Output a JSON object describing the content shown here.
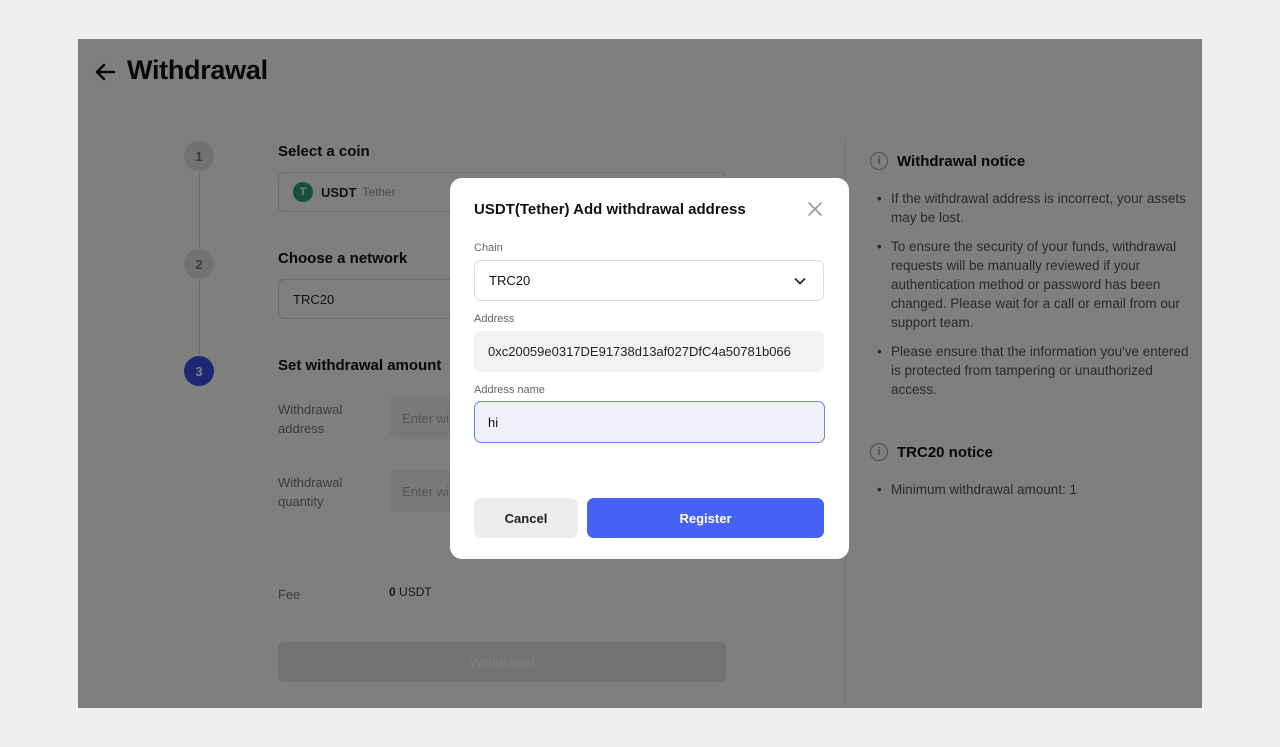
{
  "page": {
    "title": "Withdrawal"
  },
  "steps": [
    {
      "number": "1",
      "title": "Select a coin"
    },
    {
      "number": "2",
      "title": "Choose a network"
    },
    {
      "number": "3",
      "title": "Set withdrawal amount"
    }
  ],
  "coin": {
    "symbol": "USDT",
    "name": "Tether",
    "icon_letter": "T"
  },
  "network": {
    "value": "TRC20"
  },
  "amount_form": {
    "address_label": "Withdrawal address",
    "address_placeholder": "Enter wi",
    "quantity_label": "Withdrawal quantity",
    "quantity_placeholder": "Enter wi",
    "fee_label": "Fee",
    "fee_amount": "0",
    "fee_unit": "USDT",
    "submit_label": "Withdrawal"
  },
  "withdrawal_notice": {
    "title": "Withdrawal notice",
    "items": [
      "If the withdrawal address is incorrect, your assets may be lost.",
      "To ensure the security of your funds, withdrawal requests will be manually reviewed if your authentication method or password has been changed. Please wait for a call or email from our support team.",
      "Please ensure that the information you've entered is protected from tampering or unauthorized access."
    ]
  },
  "trc20_notice": {
    "title": "TRC20 notice",
    "items": [
      "Minimum withdrawal amount: 1"
    ]
  },
  "modal": {
    "title": "USDT(Tether) Add withdrawal address",
    "chain_label": "Chain",
    "chain_value": "TRC20",
    "address_label": "Address",
    "address_value": "0xc20059e0317DE91738d13af027DfC4a50781b066",
    "address_name_label": "Address name",
    "address_name_value": "hi",
    "cancel_label": "Cancel",
    "register_label": "Register"
  },
  "colors": {
    "accent": "#4760f5",
    "step_active": "#3b4ee8",
    "tether": "#26a17b"
  }
}
